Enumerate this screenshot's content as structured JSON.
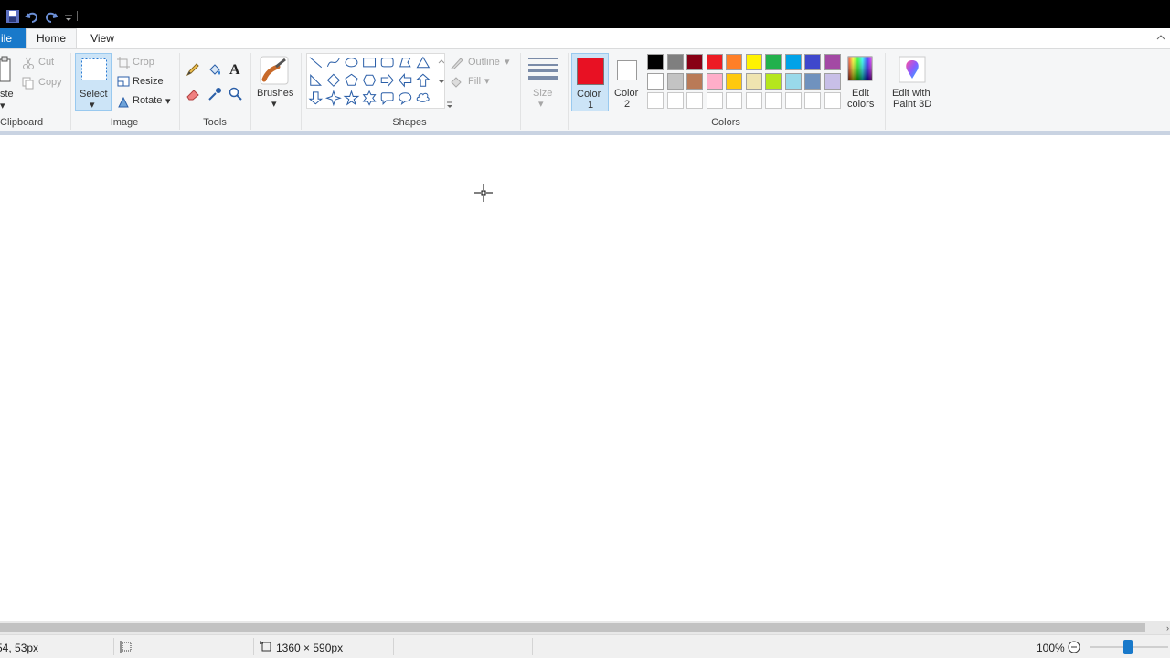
{
  "quick_access": {
    "icons": [
      "save-icon",
      "undo-icon",
      "redo-icon",
      "customize-quick-access-icon"
    ]
  },
  "tabs": {
    "file_label": "ile",
    "home_label": "Home",
    "view_label": "View"
  },
  "clipboard": {
    "paste_label": "ste",
    "cut_label": "Cut",
    "copy_label": "Copy",
    "group_label": "Clipboard"
  },
  "image": {
    "select_label": "Select",
    "crop_label": "Crop",
    "resize_label": "Resize",
    "rotate_label": "Rotate",
    "group_label": "Image"
  },
  "tools": {
    "group_label": "Tools",
    "items": [
      "pencil",
      "fill",
      "text",
      "eraser",
      "color-picker",
      "magnifier"
    ]
  },
  "brushes": {
    "label": "Brushes"
  },
  "shapes": {
    "group_label": "Shapes",
    "outline_label": "Outline",
    "fill_label": "Fill",
    "items": [
      "line",
      "curve",
      "oval",
      "rectangle",
      "rounded-rectangle",
      "polygon",
      "triangle",
      "right-triangle",
      "diamond",
      "pentagon",
      "hexagon",
      "right-arrow",
      "left-arrow",
      "up-arrow",
      "down-arrow",
      "four-point-star",
      "five-point-star",
      "six-point-star",
      "rounded-callout",
      "oval-callout",
      "cloud-callout"
    ]
  },
  "size": {
    "label": "Size"
  },
  "colors": {
    "group_label": "Colors",
    "color1_label": "Color",
    "color1_num": "1",
    "color1_value": "#e81123",
    "color2_label": "Color",
    "color2_num": "2",
    "color2_value": "#ffffff",
    "edit_colors_line1": "Edit",
    "edit_colors_line2": "colors",
    "paint3d_line1": "Edit with",
    "paint3d_line2": "Paint 3D",
    "palette_row1": [
      "#000000",
      "#7f7f7f",
      "#880015",
      "#ed1c24",
      "#ff7f27",
      "#fff200",
      "#22b14c",
      "#00a2e8",
      "#3f48cc",
      "#a349a4"
    ],
    "palette_row2": [
      "#ffffff",
      "#c3c3c3",
      "#b97a57",
      "#ffaec9",
      "#ffc90e",
      "#efe4b0",
      "#b5e61d",
      "#99d9ea",
      "#7092be",
      "#c8bfe7"
    ]
  },
  "status": {
    "cursor_pos": "54, 53px",
    "canvas_size": "1360 × 590px",
    "zoom": "100%",
    "zoom_fraction": 0.5
  }
}
